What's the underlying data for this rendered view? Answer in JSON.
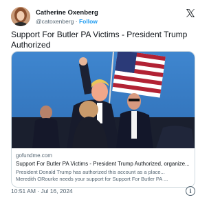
{
  "author": {
    "name": "Catherine Oxenberg",
    "handle": "@catoxenberg",
    "separator": " · ",
    "follow_label": "Follow"
  },
  "icons": {
    "platform": "x-logo-icon",
    "info": "info-icon"
  },
  "tweet": {
    "text": "Support For Butler PA Victims - President Trump Authorized",
    "timestamp": "10:51 AM · Jul 16, 2024"
  },
  "card": {
    "domain": "gofundme.com",
    "title": "Support For Butler PA Victims - President Trump Authorized, organize...",
    "description_line1": "President Donald Trump has authorized this account as a place...",
    "description_line2": "Meredith ORourke needs your support for Support For Butler PA ..."
  },
  "info_glyph": "i"
}
